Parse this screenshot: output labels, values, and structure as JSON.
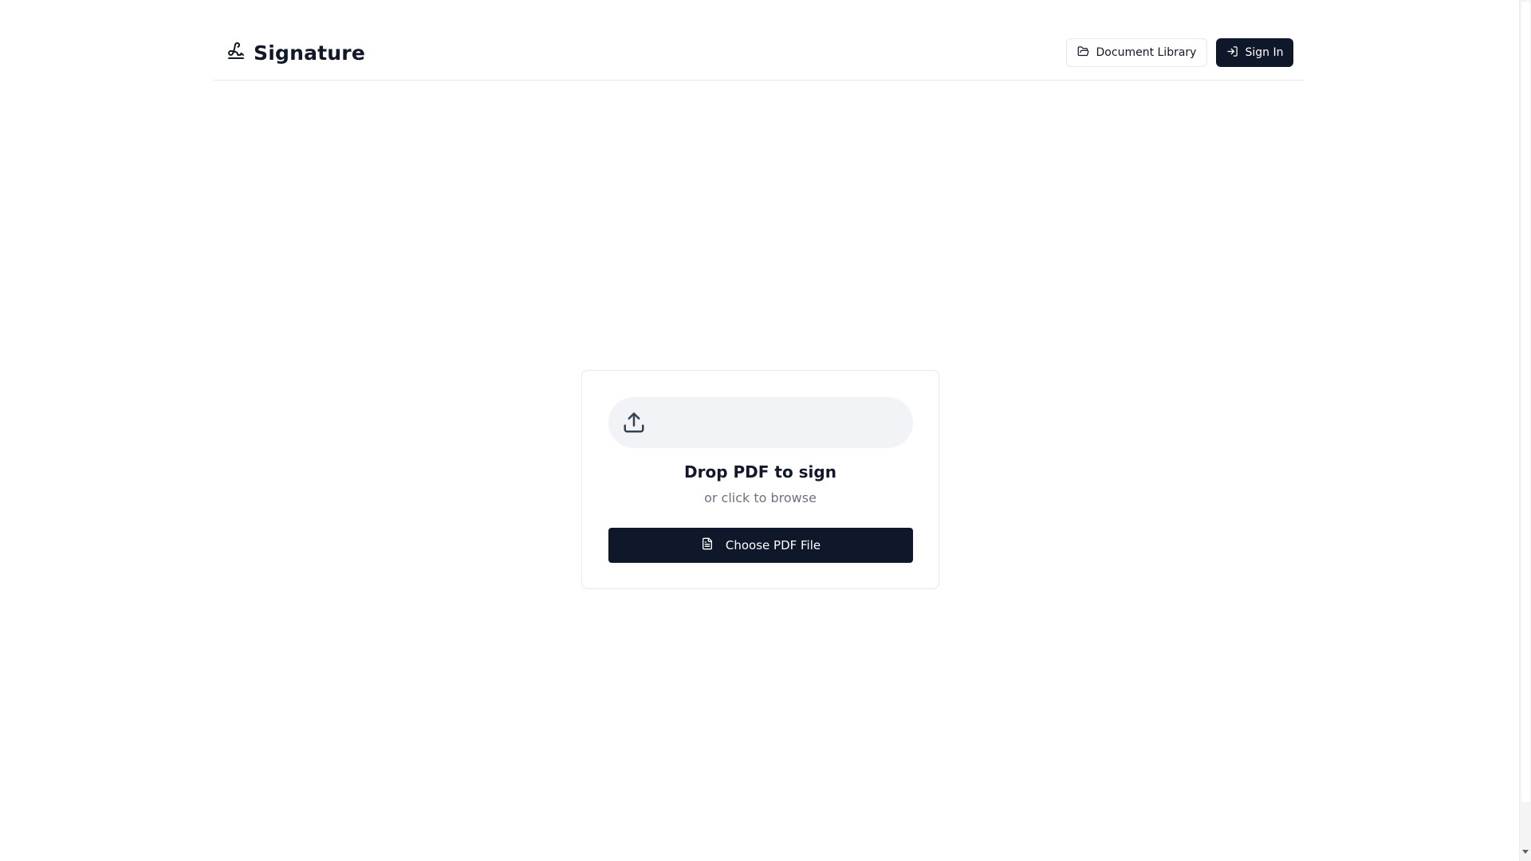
{
  "app": {
    "name": "Signature",
    "logo_icon": "signature-icon"
  },
  "header": {
    "document_library_label": "Document Library",
    "document_library_icon": "folder-open-icon",
    "sign_in_label": "Sign In",
    "sign_in_icon": "sign-in-icon"
  },
  "upload": {
    "icon": "upload-icon",
    "title": "Drop PDF to sign",
    "subtitle": "or click to browse",
    "button_label": "Choose PDF File",
    "button_icon": "file-text-icon"
  },
  "colors": {
    "primary": "#0f172a",
    "border": "#e5e7eb",
    "muted_text": "#6b7280",
    "dropzone_bg": "#f1f3f7"
  }
}
